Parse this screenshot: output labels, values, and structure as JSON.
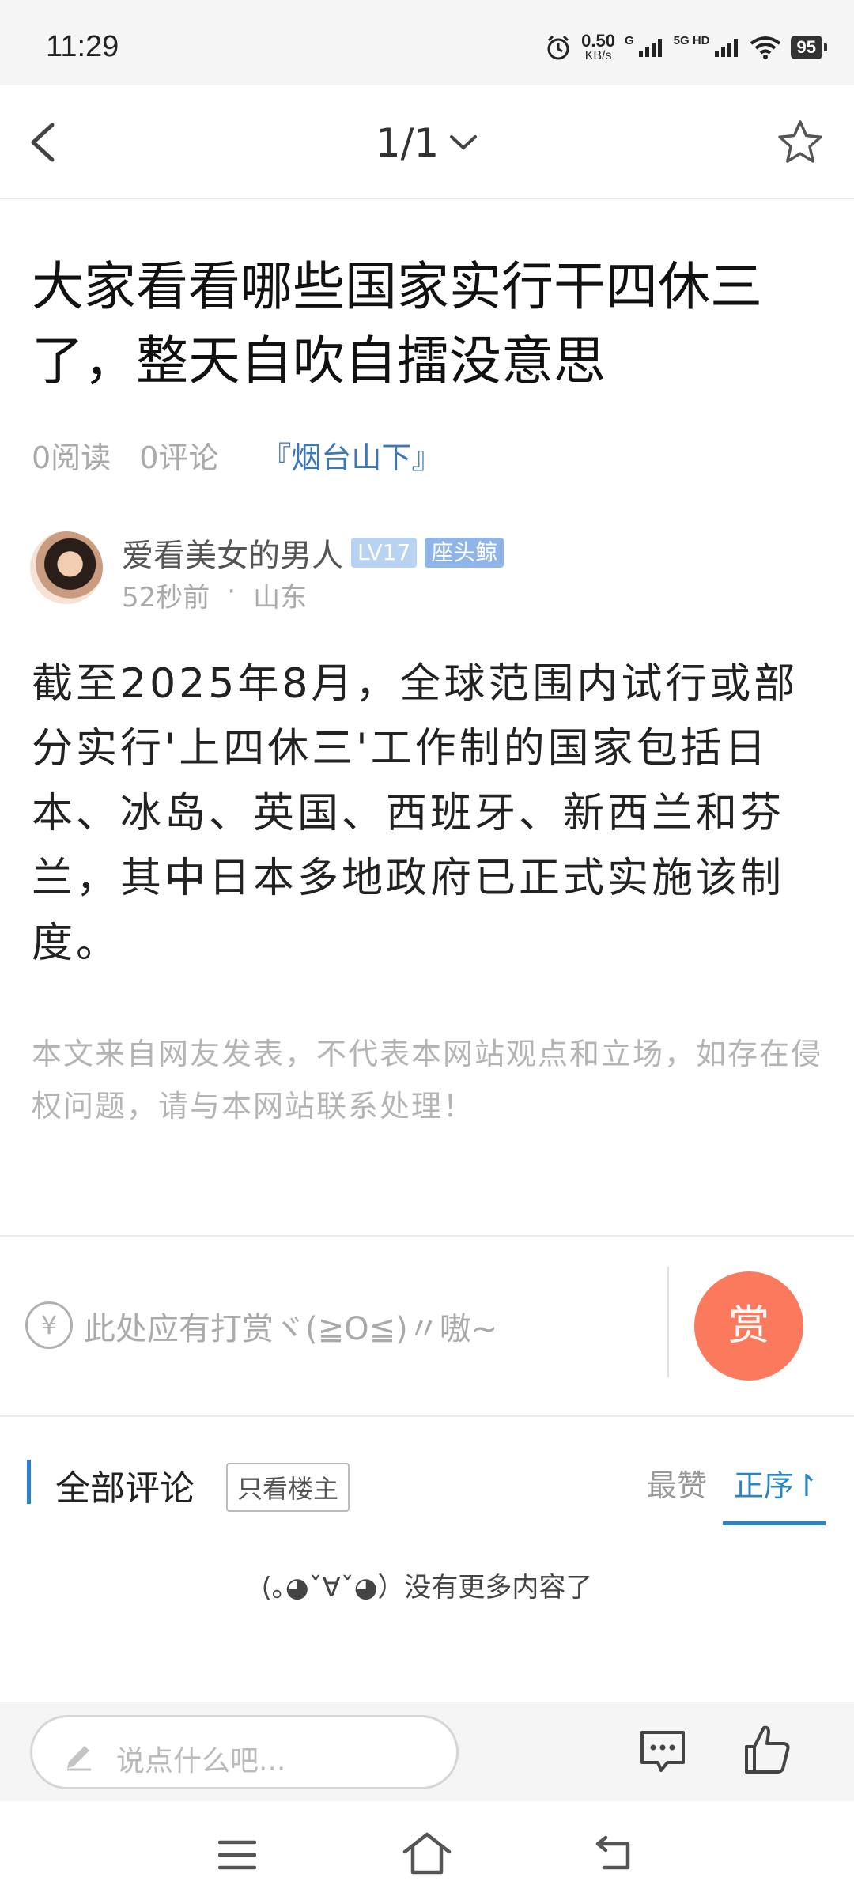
{
  "status_bar": {
    "time": "11:29",
    "net_speed_value": "0.50",
    "net_speed_unit": "KB/s",
    "sig1_tag": "G",
    "sig2_tag": "5G HD",
    "battery": "95"
  },
  "nav": {
    "pager": "1/1",
    "icons": [
      "back-arrow-icon",
      "chevron-down-icon",
      "star-icon"
    ]
  },
  "article": {
    "title": "大家看看哪些国家实行干四休三了，整天自吹自擂没意思",
    "reads": "0阅读",
    "comments_count": "0评论",
    "forum": "『烟台山下』",
    "author": {
      "name": "爱看美女的男人",
      "level": "LV17",
      "rank": "座头鲸",
      "time": "52秒前",
      "sep": "·",
      "location": "山东"
    },
    "body": "截至2025年8月，全球范围内试行或部分实行'上四休三'工作制的国家包括日本、冰岛、英国、西班牙、新西兰和芬兰，其中日本多地政府已正式实施该制度。",
    "disclaimer": "本文来自网友发表，不代表本网站观点和立场，如存在侵权问题，请与本网站联系处理！"
  },
  "reward": {
    "icon_text": "¥",
    "text": "此处应有打赏ヾ(≧O≦)〃嗷~",
    "button": "赏"
  },
  "comments": {
    "title": "全部评论",
    "only_op": "只看楼主",
    "sort_hot": "最赞",
    "sort_asc": "正序↾",
    "empty_text": "(｡◕ˇ∀ˇ◕）没有更多内容了"
  },
  "bottom_bar": {
    "placeholder": "说点什么吧..."
  },
  "colors": {
    "accent_blue": "#2a86c2",
    "forum_blue": "#3d78b5",
    "reward_orange": "#fb7a5d"
  }
}
